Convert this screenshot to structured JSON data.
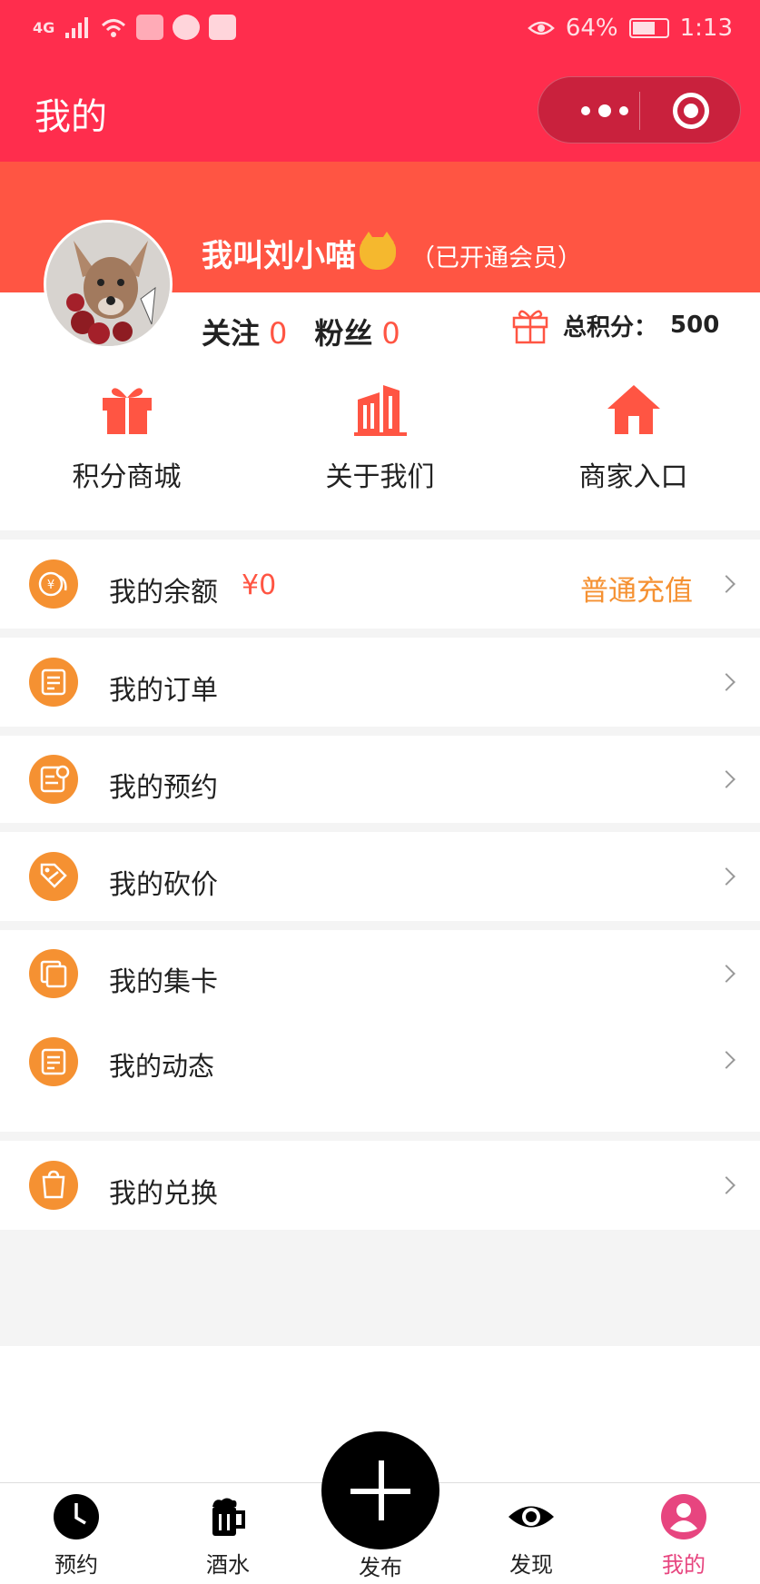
{
  "status": {
    "signal": "4G",
    "battery": "64%",
    "time": "1:13"
  },
  "nav": {
    "title": "我的"
  },
  "profile": {
    "name": "我叫刘小喵",
    "membership": "（已开通会员）",
    "follow_label": "关注",
    "follow_count": "0",
    "fans_label": "粉丝",
    "fans_count": "0",
    "points_label": "总积分：",
    "points_value": "500"
  },
  "shortcuts": [
    {
      "label": "积分商城",
      "icon": "gift-icon"
    },
    {
      "label": "关于我们",
      "icon": "building-icon"
    },
    {
      "label": "商家入口",
      "icon": "home-icon"
    }
  ],
  "menu": {
    "balance": {
      "label": "我的余额",
      "amount": "¥0",
      "action": "普通充值"
    },
    "items": [
      {
        "label": "我的订单",
        "icon": "order-icon"
      },
      {
        "label": "我的预约",
        "icon": "appointment-icon"
      },
      {
        "label": "我的砍价",
        "icon": "bargain-icon"
      },
      {
        "label": "我的集卡",
        "icon": "cards-icon"
      },
      {
        "label": "我的动态",
        "icon": "feed-icon"
      },
      {
        "label": "我的兑换",
        "icon": "exchange-icon"
      }
    ]
  },
  "tabbar": [
    {
      "label": "预约",
      "icon": "clock-icon"
    },
    {
      "label": "酒水",
      "icon": "beer-icon"
    },
    {
      "label": "发布",
      "icon": "plus-icon"
    },
    {
      "label": "发现",
      "icon": "eye-icon"
    },
    {
      "label": "我的",
      "icon": "user-icon",
      "active": true
    }
  ],
  "colors": {
    "header": "#ff2d4d",
    "profile": "#ff5543",
    "accent_orange": "#f59132",
    "active_tab": "#e7457f"
  }
}
